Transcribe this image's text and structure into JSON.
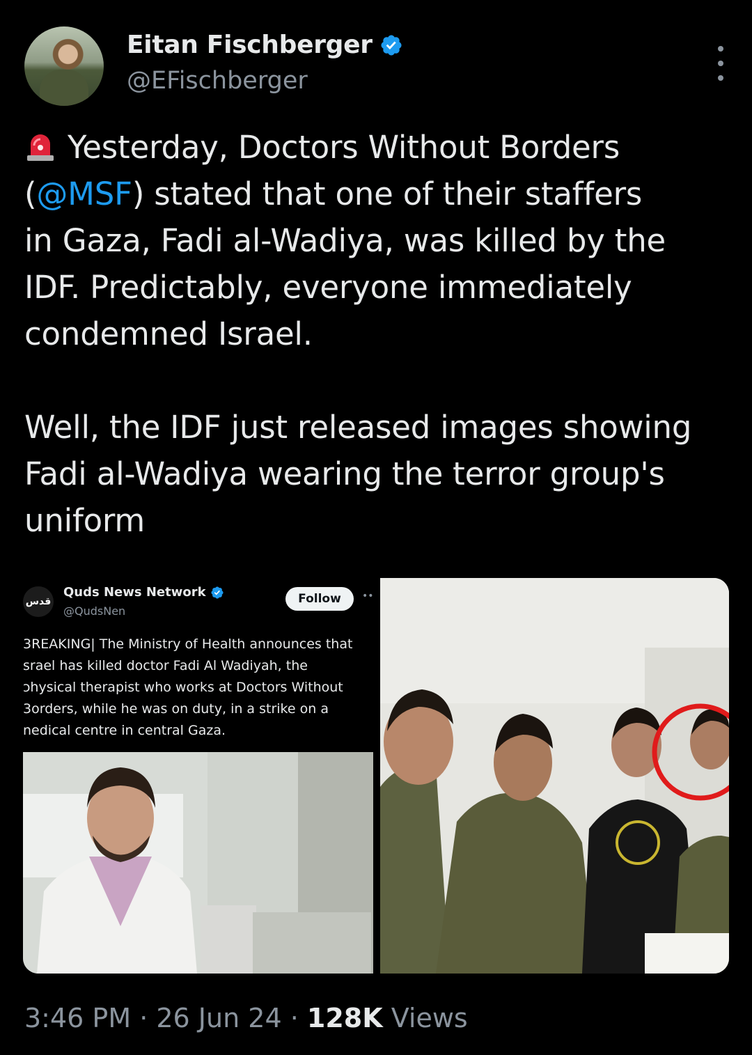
{
  "author": {
    "name": "Eitan Fischberger",
    "handle": "@EFischberger",
    "verified": true
  },
  "tweet": {
    "siren_icon": "rotating-light-emoji",
    "line1_pre": "Yesterday, Doctors Without Borders",
    "line2_paren_open": "(",
    "mention": "@MSF",
    "line2_rest": ") stated that one of their staffers",
    "line3": "in Gaza, Fadi al-Wadiya, was killed by the",
    "line4": "IDF. Predictably, everyone immediately",
    "line5": "condemned Israel.",
    "line6": "Well, the IDF just released images showing",
    "line7": "Fadi al-Wadiya wearing the terror group's",
    "line8": "uniform"
  },
  "quoted": {
    "logo_text": "قدس",
    "name": "Quds News Network",
    "handle": "@QudsNen",
    "follow_label": "Follow",
    "text_lines": [
      "3REAKING| The Ministry of Health announces that",
      "srael has killed doctor Fadi Al Wadiyah, the",
      "ɔhysical therapist who works at Doctors Without",
      "3orders,  while he was on duty, in a strike on a",
      "nedical centre in central Gaza."
    ]
  },
  "footer": {
    "time": "3:46 PM",
    "sep": " · ",
    "date": "26 Jun 24",
    "views_count": "128K",
    "views_label": " Views"
  },
  "colors": {
    "background": "#000000",
    "text": "#e7e9ea",
    "secondary": "#8b949e",
    "link": "#1d9bf0",
    "verified": "#1d9bf0"
  }
}
